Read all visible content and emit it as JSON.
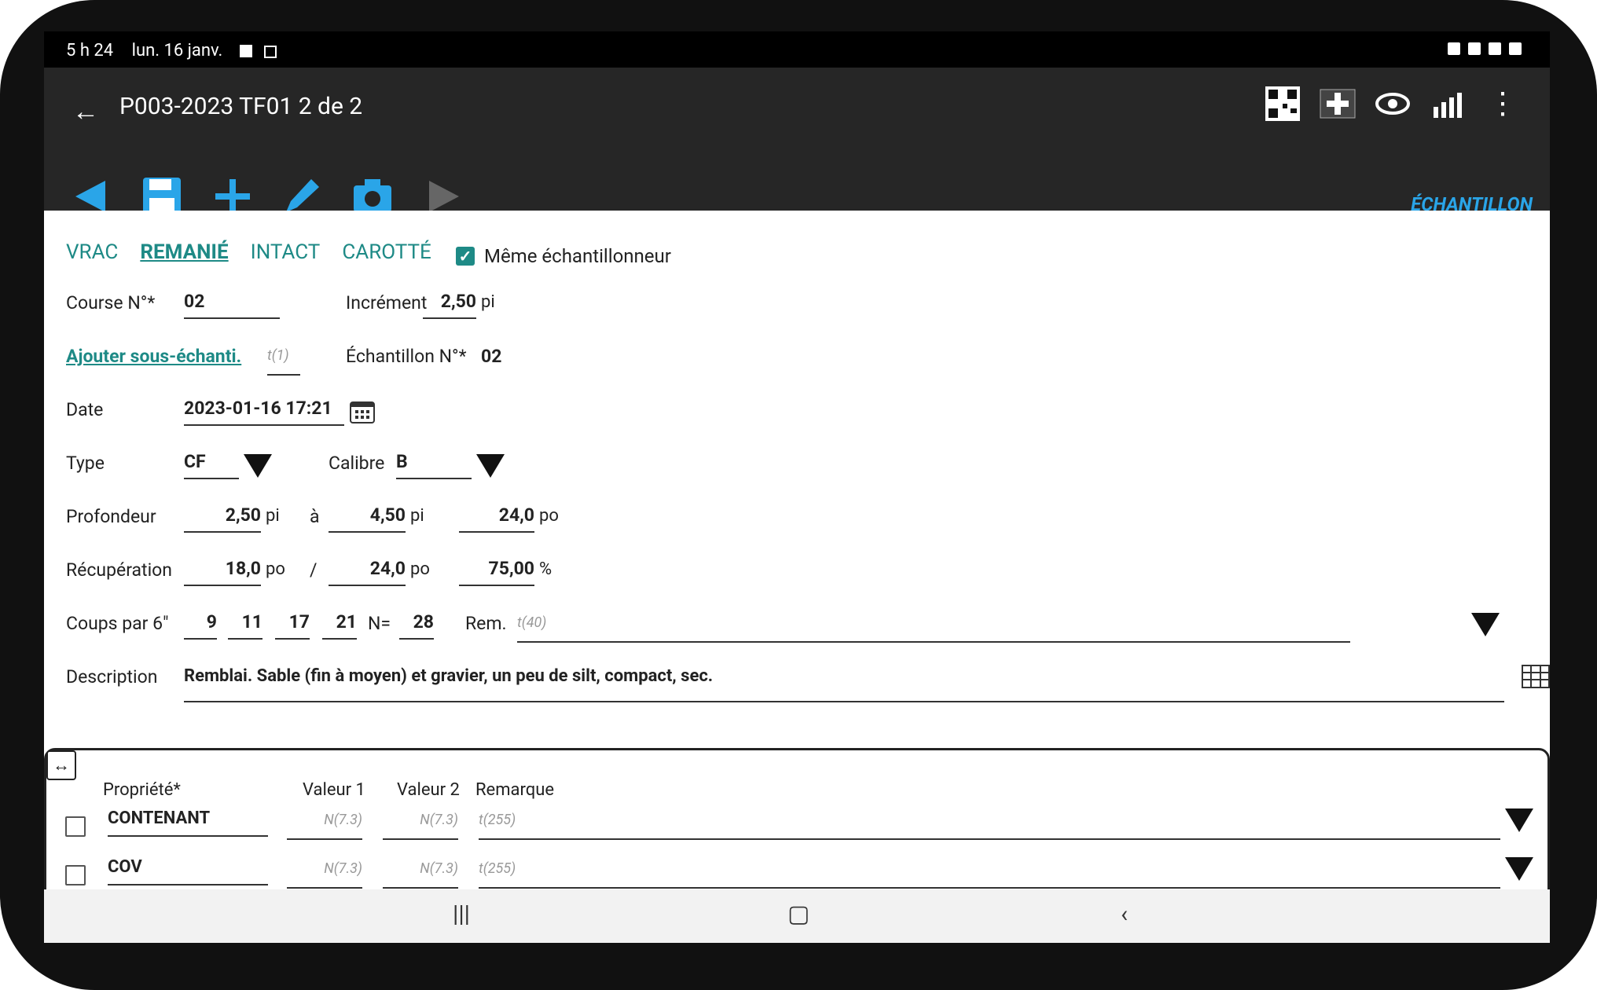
{
  "status": {
    "time": "5 h 24",
    "date": "lun. 16 janv."
  },
  "app": {
    "title": "P003-2023  TF01  2 de 2",
    "section_label": "ÉCHANTILLON"
  },
  "tabs": [
    "VRAC",
    "REMANIÉ",
    "INTACT",
    "CAROTTÉ"
  ],
  "same_sampler": {
    "label": "Même échantillonneur",
    "checked": true
  },
  "form": {
    "course": {
      "label": "Course N°*",
      "value": "02"
    },
    "increment": {
      "label": "Incrément",
      "value": "2,50",
      "unit": "pi"
    },
    "add_sub": {
      "label": "Ajouter sous-échanti.",
      "hint": "t(1)"
    },
    "sample_no": {
      "label": "Échantillon N°*",
      "value": "02"
    },
    "date": {
      "label": "Date",
      "value": "2023-01-16 17:21"
    },
    "type": {
      "label": "Type",
      "value": "CF"
    },
    "calibre": {
      "label": "Calibre",
      "value": "B"
    },
    "profondeur": {
      "label": "Profondeur",
      "from": "2,50",
      "from_unit": "pi",
      "sep": "à",
      "to": "4,50",
      "to_unit": "pi",
      "len": "24,0",
      "len_unit": "po"
    },
    "recuperation": {
      "label": "Récupération",
      "a": "18,0",
      "a_unit": "po",
      "sep": "/",
      "b": "24,0",
      "b_unit": "po",
      "pct": "75,00",
      "pct_unit": "%"
    },
    "coups": {
      "label": "Coups par 6\"",
      "values": [
        "9",
        "11",
        "17",
        "21"
      ],
      "n_label": "N=",
      "n": "28",
      "rem_label": "Rem.",
      "rem_hint": "t(40)"
    },
    "description": {
      "label": "Description",
      "value": "Remblai. Sable (fin à moyen) et gravier, un peu de silt, compact, sec."
    }
  },
  "table": {
    "headers": [
      "Propriété*",
      "Valeur 1",
      "Valeur 2",
      "Remarque"
    ],
    "rows": [
      {
        "prop": "CONTENANT",
        "v1": "N(7.3)",
        "v2": "N(7.3)",
        "rem": "t(255)"
      },
      {
        "prop": "COV",
        "v1": "N(7.3)",
        "v2": "N(7.3)",
        "rem": "t(255)"
      }
    ]
  }
}
